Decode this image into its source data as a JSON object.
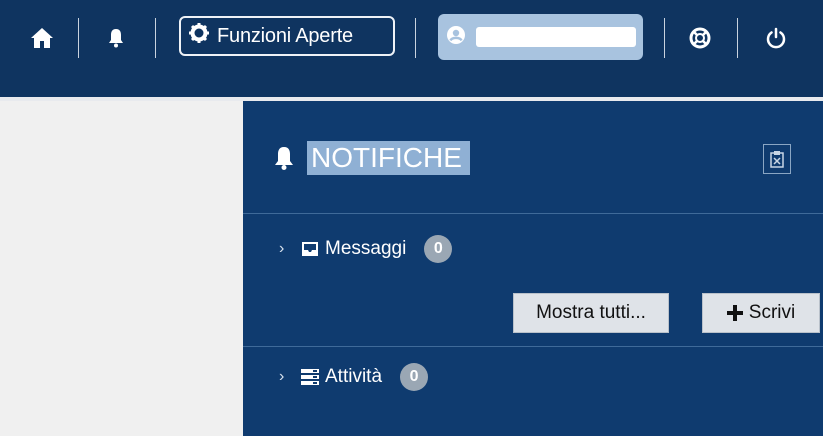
{
  "topbar": {
    "home_icon": "home-icon",
    "bell_icon": "bell-icon",
    "funzioni_label": "Funzioni Aperte",
    "support_icon": "lifebuoy-icon",
    "power_icon": "power-icon"
  },
  "notifications": {
    "title": "NOTIFICHE",
    "messaggi": {
      "label": "Messaggi",
      "count": "0"
    },
    "attivita": {
      "label": "Attività",
      "count": "0"
    },
    "show_all_label": "Mostra tutti...",
    "write_label": "Scrivi"
  },
  "colors": {
    "topbar": "#0f3460",
    "panel": "#0f3b6f",
    "title_highlight": "#8fb0d4"
  }
}
